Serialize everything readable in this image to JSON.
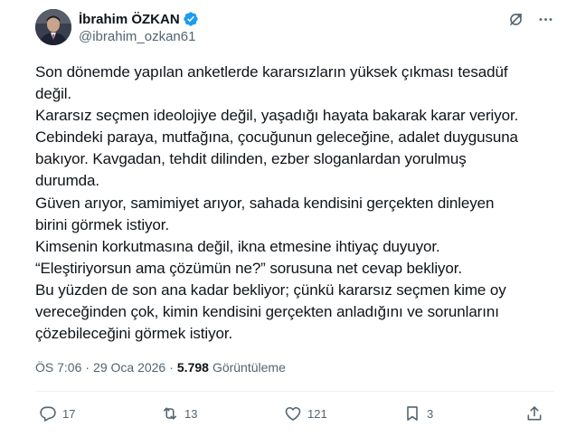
{
  "author": {
    "display_name": "İbrahim ÖZKAN",
    "handle": "@ibrahim_ozkan61",
    "verified": true,
    "verified_color": "#1d9bf0"
  },
  "tweet": {
    "text": "Son dönemde yapılan anketlerde kararsızların yüksek çıkması tesadüf\ndeğil.\nKararsız seçmen ideolojiye değil, yaşadığı hayata bakarak karar veriyor.\nCebindeki paraya, mutfağına, çocuğunun geleceğine, adalet duygusuna\nbakıyor. Kavgadan, tehdit dilinden, ezber sloganlardan yorulmuş\ndurumda.\nGüven arıyor, samimiyet arıyor, sahada kendisini gerçekten dinleyen\nbirini görmek istiyor.\nKimsenin korkutmasına değil, ikna etmesine ihtiyaç duyuyor.\n“Eleştiriyorsun ama çözümün ne?” sorusuna net cevap bekliyor.\nBu yüzden de son ana kadar bekliyor; çünkü kararsız seçmen kime oy\nvereceğinden çok, kimin kendisini gerçekten anladığını ve sorunlarını\nçözebileceğini görmek istiyor."
  },
  "meta": {
    "time": "ÖS 7:06",
    "separator": "·",
    "date": "29 Oca 2026",
    "views_count": "5.798",
    "views_label": "Görüntüleme"
  },
  "actions": {
    "reply_count": "17",
    "retweet_count": "13",
    "like_count": "121",
    "bookmark_count": "3"
  },
  "icons": {
    "header": [
      "grok-icon",
      "more-options-icon"
    ],
    "actions": [
      "reply-icon",
      "retweet-icon",
      "like-icon",
      "bookmark-icon",
      "share-icon"
    ]
  },
  "colors": {
    "text": "#0f1419",
    "secondary": "#536471",
    "divider": "#eff3f4"
  }
}
